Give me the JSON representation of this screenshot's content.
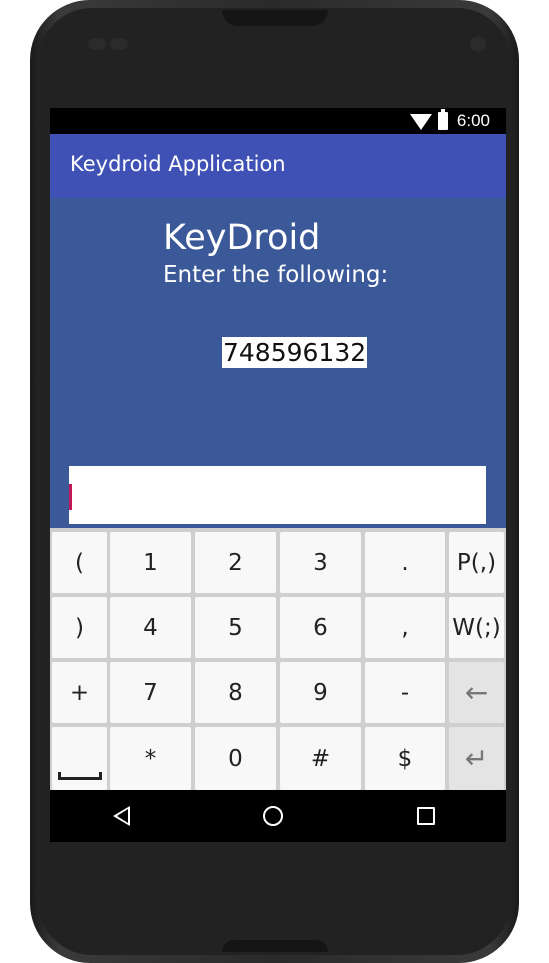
{
  "status_bar": {
    "time": "6:00",
    "icons": [
      "wifi-icon",
      "battery-icon"
    ]
  },
  "app_bar": {
    "title": "Keydroid Application",
    "color": "#3f51b5"
  },
  "content": {
    "background": "#3b5998",
    "brand": "KeyDroid",
    "prompt": "Enter the following:",
    "code": "748596132",
    "input_value": ""
  },
  "keyboard": {
    "rows": [
      [
        "(",
        "1",
        "2",
        "3",
        ".",
        "P(,)"
      ],
      [
        ")",
        "4",
        "5",
        "6",
        ",",
        "W(;)"
      ],
      [
        "+",
        "7",
        "8",
        "9",
        "-",
        "backspace-icon"
      ],
      [
        "space-icon",
        "*",
        "0",
        "#",
        "$",
        "enter-icon"
      ]
    ],
    "labels": {
      "r0": [
        "(",
        "1",
        "2",
        "3",
        ".",
        "P(,)"
      ],
      "r1": [
        ")",
        "4",
        "5",
        "6",
        ",",
        "W(;)"
      ],
      "r2": [
        "+",
        "7",
        "8",
        "9",
        "-",
        "←"
      ],
      "r3": [
        "",
        "*",
        "0",
        "#",
        "$",
        "↵"
      ]
    }
  },
  "nav_bar": {
    "icons": [
      "back-icon",
      "home-icon",
      "recents-icon"
    ]
  }
}
